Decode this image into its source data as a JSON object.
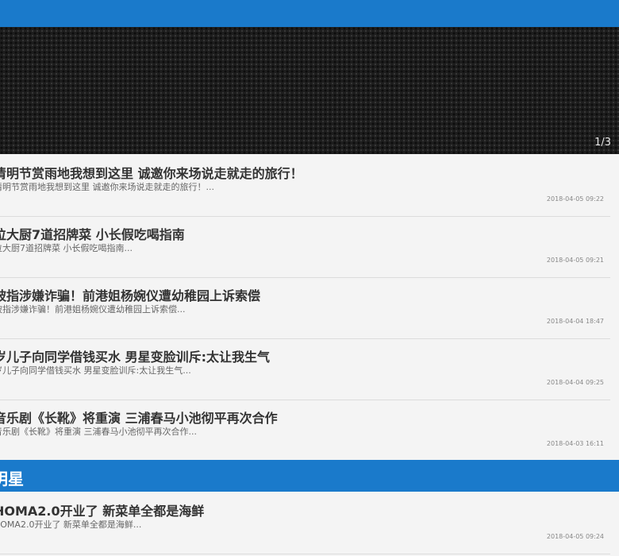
{
  "banner": {
    "counter": "1/3"
  },
  "articles": [
    {
      "title": "清明节赏雨地我想到这里 诚邀你来场说走就走的旅行！",
      "summary": "清明节赏雨地我想到这里 诚邀你来场说走就走的旅行！...",
      "time": "2018-04-05 09:22"
    },
    {
      "title": "位大厨7道招牌菜 小长假吃喝指南",
      "summary": "位大厨7道招牌菜 小长假吃喝指南...",
      "time": "2018-04-05 09:21"
    },
    {
      "title": "被指涉嫌诈骗！前港姐杨婉仪遭幼稚园上诉索偿",
      "summary": "被指涉嫌诈骗！前港姐杨婉仪遭幼稚园上诉索偿...",
      "time": "2018-04-04 18:47"
    },
    {
      "title": "岁儿子向同学借钱买水 男星变脸训斥:太让我生气",
      "summary": "岁儿子向同学借钱买水 男星变脸训斥:太让我生气...",
      "time": "2018-04-04 09:25"
    },
    {
      "title": "音乐剧《长靴》将重演 三浦春马小池彻平再次合作",
      "summary": "音乐剧《长靴》将重演 三浦春马小池彻平再次合作...",
      "time": "2018-04-03 16:11"
    }
  ],
  "section": {
    "title": "明星"
  },
  "section_articles": [
    {
      "title": "HOMA2.0开业了 新菜单全都是海鲜",
      "summary": "HOMA2.0开业了 新菜单全都是海鲜...",
      "time": "2018-04-05 09:24"
    }
  ]
}
